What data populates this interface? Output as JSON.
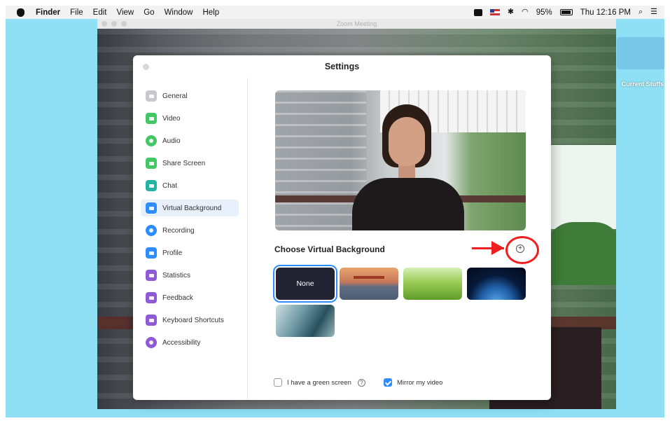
{
  "menubar": {
    "apple_icon": "apple-icon",
    "app_name": "Finder",
    "menus": [
      "File",
      "Edit",
      "View",
      "Go",
      "Window",
      "Help"
    ],
    "battery_percent": "95%",
    "clock": "Thu 12:16 PM",
    "status_icons": [
      "screen-record-icon",
      "us-flag-icon",
      "bluetooth-icon",
      "wifi-icon",
      "battery-icon",
      "search-icon",
      "list-icon"
    ]
  },
  "desktop": {
    "folder_label": "Current Stuffs"
  },
  "zoom_window": {
    "title": "Zoom Meeting"
  },
  "settings": {
    "title": "Settings",
    "nav_items": [
      {
        "label": "General",
        "icon": "gear-icon",
        "color": "#c8c8cc"
      },
      {
        "label": "Video",
        "icon": "video-icon",
        "color": "#43c765"
      },
      {
        "label": "Audio",
        "icon": "headphones-icon",
        "color": "#43c765"
      },
      {
        "label": "Share Screen",
        "icon": "share-screen-icon",
        "color": "#43c765"
      },
      {
        "label": "Chat",
        "icon": "chat-icon",
        "color": "#25b3a3"
      },
      {
        "label": "Virtual Background",
        "icon": "virtual-background-icon",
        "color": "#2d8cff"
      },
      {
        "label": "Recording",
        "icon": "recording-icon",
        "color": "#2d8cff"
      },
      {
        "label": "Profile",
        "icon": "profile-icon",
        "color": "#2d8cff"
      },
      {
        "label": "Statistics",
        "icon": "statistics-icon",
        "color": "#8e5ad6"
      },
      {
        "label": "Feedback",
        "icon": "feedback-icon",
        "color": "#8e5ad6"
      },
      {
        "label": "Keyboard Shortcuts",
        "icon": "keyboard-icon",
        "color": "#8e5ad6"
      },
      {
        "label": "Accessibility",
        "icon": "accessibility-icon",
        "color": "#8e5ad6"
      }
    ],
    "active_item": "Virtual Background",
    "choose_title": "Choose Virtual Background",
    "add_button_symbol": "+",
    "backgrounds": [
      {
        "label": "None",
        "selected": true
      },
      {
        "label": "",
        "image": "golden-gate-bridge"
      },
      {
        "label": "",
        "image": "grass"
      },
      {
        "label": "",
        "image": "earth-from-space"
      },
      {
        "label": "",
        "image": "ocean-wave"
      }
    ],
    "green_screen_label": "I have a green screen",
    "green_screen_checked": false,
    "help_symbol": "?",
    "mirror_label": "Mirror my video",
    "mirror_checked": true
  },
  "colors": {
    "desktop": "#8fe0f4",
    "accent": "#2d8cff",
    "annotation": "#f01e1e"
  }
}
